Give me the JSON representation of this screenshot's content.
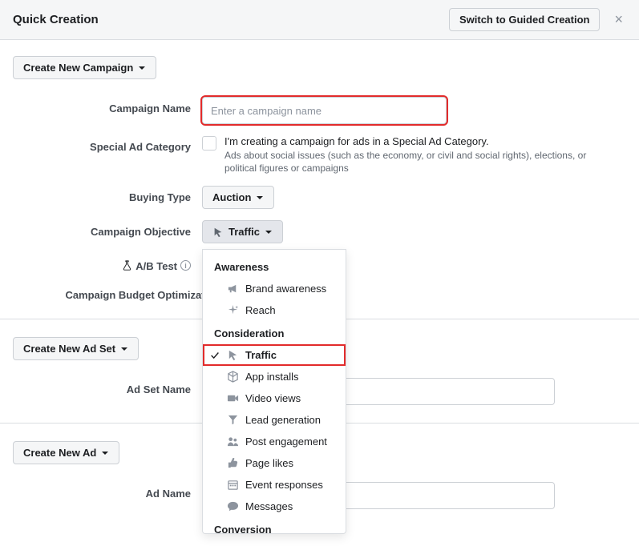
{
  "header": {
    "title": "Quick Creation",
    "switch_button": "Switch to Guided Creation"
  },
  "campaign": {
    "create_button": "Create New Campaign",
    "name_label": "Campaign Name",
    "name_placeholder": "Enter a campaign name",
    "special_cat_label": "Special Ad Category",
    "special_cat_primary": "I'm creating a campaign for ads in a Special Ad Category.",
    "special_cat_secondary": "Ads about social issues (such as the economy, or civil and social rights), elections, or political figures or campaigns",
    "buying_type_label": "Buying Type",
    "buying_type_value": "Auction",
    "objective_label": "Campaign Objective",
    "objective_value": "Traffic",
    "abtest_label": "A/B Test",
    "cbo_label": "Campaign Budget Optimization"
  },
  "objective_dropdown": {
    "groups": [
      {
        "label": "Awareness",
        "items": [
          {
            "key": "brand-awareness",
            "label": "Brand awareness",
            "icon": "megaphone"
          },
          {
            "key": "reach",
            "label": "Reach",
            "icon": "sparkle"
          }
        ]
      },
      {
        "label": "Consideration",
        "items": [
          {
            "key": "traffic",
            "label": "Traffic",
            "icon": "cursor",
            "selected": true
          },
          {
            "key": "app-installs",
            "label": "App installs",
            "icon": "cube"
          },
          {
            "key": "video-views",
            "label": "Video views",
            "icon": "video"
          },
          {
            "key": "lead-generation",
            "label": "Lead generation",
            "icon": "funnel"
          },
          {
            "key": "post-engagement",
            "label": "Post engagement",
            "icon": "people"
          },
          {
            "key": "page-likes",
            "label": "Page likes",
            "icon": "thumb"
          },
          {
            "key": "event-responses",
            "label": "Event responses",
            "icon": "calendar"
          },
          {
            "key": "messages",
            "label": "Messages",
            "icon": "chat"
          }
        ]
      },
      {
        "label": "Conversion",
        "items": []
      }
    ]
  },
  "adset": {
    "create_button": "Create New Ad Set",
    "name_label": "Ad Set Name"
  },
  "ad": {
    "create_button": "Create New Ad",
    "name_label": "Ad Name"
  }
}
